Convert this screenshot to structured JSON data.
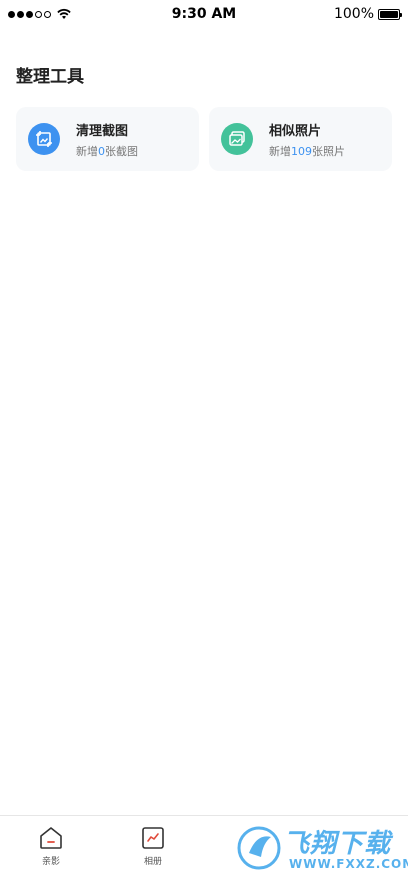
{
  "status_bar": {
    "time": "9:30 AM",
    "battery": "100%",
    "battery_level": 1.0
  },
  "header": {
    "title": "整理工具"
  },
  "cards": [
    {
      "title": "清理截图",
      "sub_prefix": "新增",
      "count": "0",
      "sub_suffix": "张截图",
      "icon": "screenshot-icon",
      "color": "#3d92f0"
    },
    {
      "title": "相似照片",
      "sub_prefix": "新增",
      "count": "109",
      "sub_suffix": "张照片",
      "icon": "gallery-icon",
      "color": "#43c29a"
    }
  ],
  "tabs": [
    {
      "label": "亲影",
      "icon": "home-icon"
    },
    {
      "label": "相册",
      "icon": "chart-icon"
    }
  ],
  "watermark": {
    "text": "飞翔下载",
    "url": "WWW.FXXZ.COM",
    "color": "#3aa4ea"
  }
}
